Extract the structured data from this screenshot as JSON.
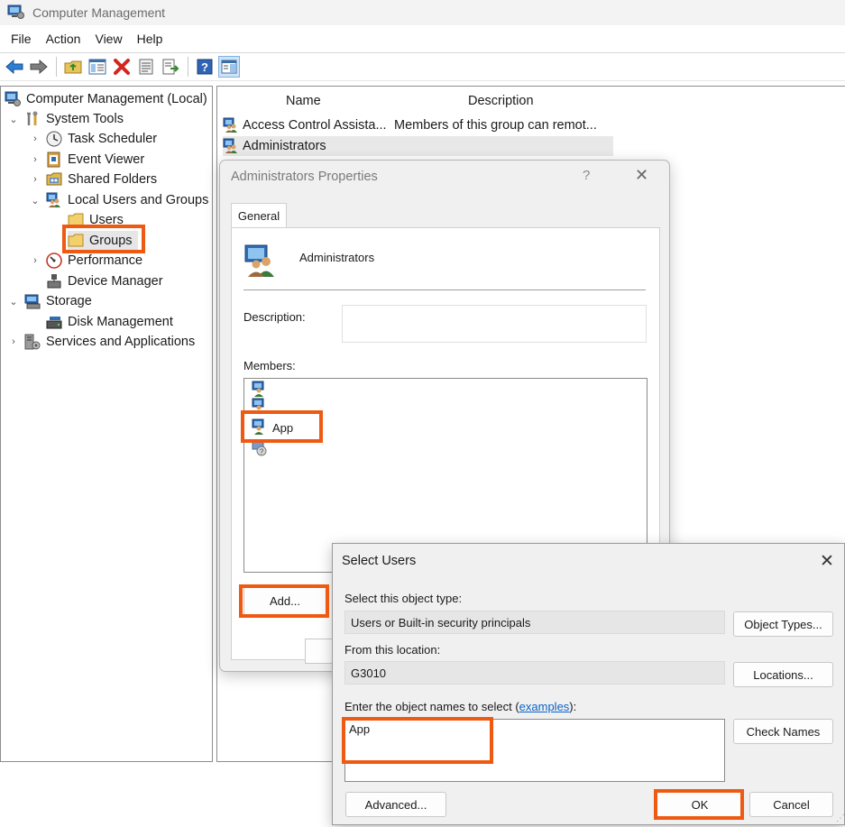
{
  "window": {
    "title": "Computer Management"
  },
  "menubar": [
    "File",
    "Action",
    "View",
    "Help"
  ],
  "toolbar": [
    "back-icon",
    "forward-icon",
    "up-folder-icon",
    "show-hide-tree-icon",
    "delete-icon",
    "properties-icon",
    "export-list-icon",
    "help-icon",
    "action-pane-icon"
  ],
  "tree": {
    "root": "Computer Management (Local)",
    "system_tools": "System Tools",
    "task_scheduler": "Task Scheduler",
    "event_viewer": "Event Viewer",
    "shared_folders": "Shared Folders",
    "local_users_groups": "Local Users and Groups",
    "users": "Users",
    "groups": "Groups",
    "performance": "Performance",
    "device_manager": "Device Manager",
    "storage": "Storage",
    "disk_management": "Disk Management",
    "services_apps": "Services and Applications"
  },
  "list": {
    "col_name": "Name",
    "col_description": "Description",
    "rows": [
      {
        "name": "Access Control Assista...",
        "description": "Members of this group can remot..."
      },
      {
        "name": "Administrators",
        "description": ""
      }
    ]
  },
  "properties_dialog": {
    "title": "Administrators Properties",
    "help": "?",
    "close": "✕",
    "tab": "General",
    "group_name": "Administrators",
    "description_label": "Description:",
    "description_value": "",
    "members_label": "Members:",
    "members": [
      "",
      "",
      "App",
      ""
    ],
    "add_button": "Add..."
  },
  "select_users_dialog": {
    "title": "Select Users",
    "close": "✕",
    "object_type_label": "Select this object type:",
    "object_type_value": "Users or Built-in security principals",
    "object_types_button": "Object Types...",
    "location_label": "From this location:",
    "location_value": "G3010",
    "locations_button": "Locations...",
    "names_label_prefix": "Enter the object names to select (",
    "names_label_link": "examples",
    "names_label_suffix": "):",
    "names_value": "App",
    "check_names_button": "Check Names",
    "advanced_button": "Advanced...",
    "ok_button": "OK",
    "cancel_button": "Cancel"
  },
  "colors": {
    "highlight": "#ef5a13",
    "link": "#0a64c8",
    "selection": "#e8e8e8"
  }
}
